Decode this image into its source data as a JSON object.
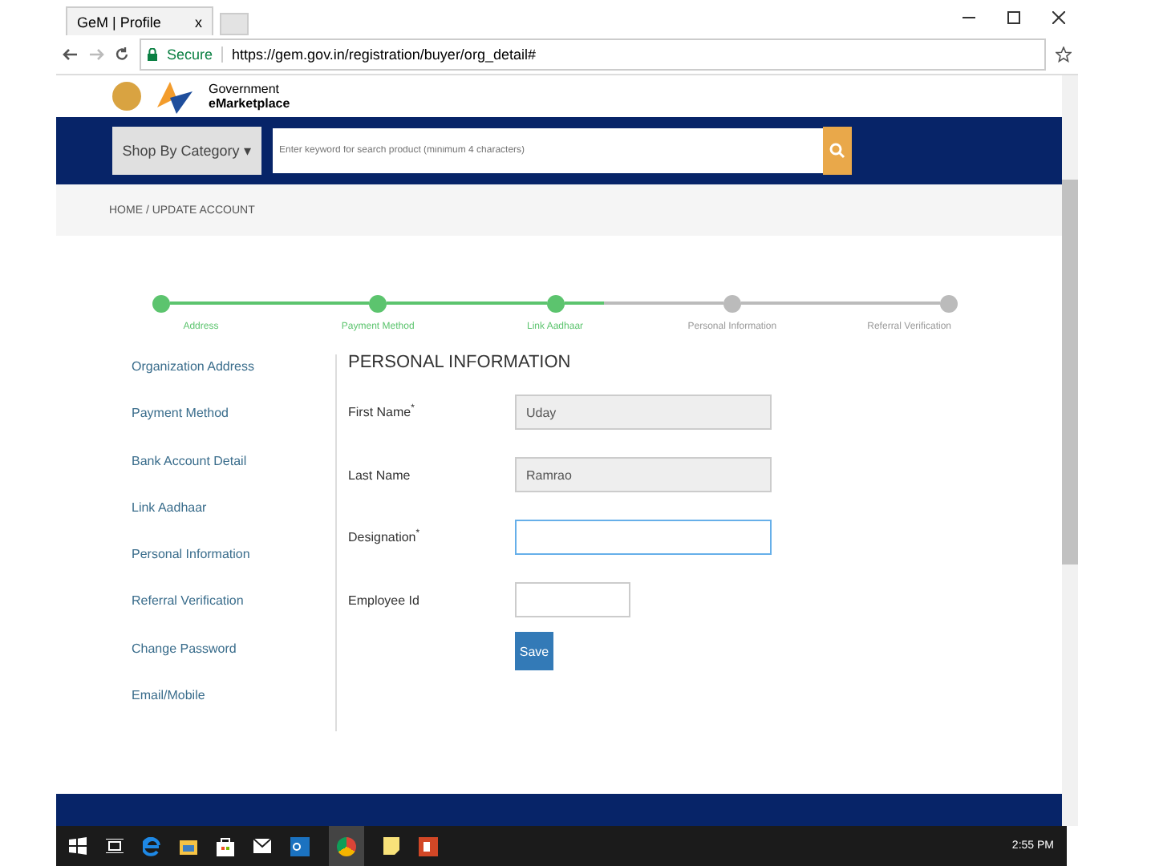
{
  "browser": {
    "tab_title": "GeM | Profile",
    "tab_close": "x",
    "secure_label": "Secure",
    "url": "https://gem.gov.in/registration/buyer/org_detail#"
  },
  "header": {
    "logo_line1": "Government",
    "logo_line2": "eMarketplace"
  },
  "search_bar": {
    "category_button": "Shop By Category ▾",
    "placeholder": "Enter keyword for search product (minimum 4 characters)"
  },
  "breadcrumb": "HOME / UPDATE ACCOUNT",
  "steps": [
    {
      "label": "Address",
      "completed": true
    },
    {
      "label": "Payment Method",
      "completed": true
    },
    {
      "label": "Link Aadhaar",
      "completed": true
    },
    {
      "label": "Personal Information",
      "completed": false
    },
    {
      "label": "Referral Verification",
      "completed": false
    }
  ],
  "sidebar": {
    "items": [
      "Organization Address",
      "Payment Method",
      "Bank Account Detail",
      "Link Aadhaar",
      "Personal Information",
      "Referral Verification",
      "Change Password",
      "Email/Mobile"
    ]
  },
  "form": {
    "title": "PERSONAL INFORMATION",
    "fields": [
      {
        "label": "First Name",
        "required": true,
        "value": "Uday",
        "disabled": true,
        "short": false,
        "focused": false
      },
      {
        "label": "Last Name",
        "required": false,
        "value": "Ramrao",
        "disabled": true,
        "short": false,
        "focused": false
      },
      {
        "label": "Designation",
        "required": true,
        "disabled": false,
        "short": false,
        "focused": true
      },
      {
        "label": "Employee Id",
        "required": false,
        "disabled": false,
        "short": true,
        "focused": false
      }
    ],
    "required_mark": "*",
    "save_button": "Save"
  },
  "taskbar": {
    "time": "2:55 PM"
  }
}
